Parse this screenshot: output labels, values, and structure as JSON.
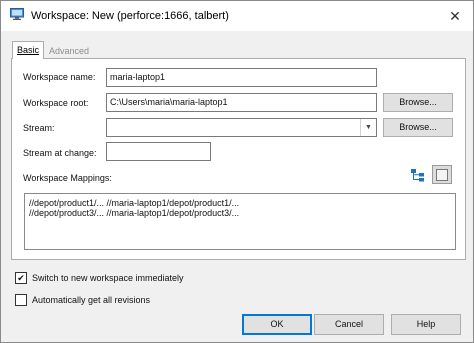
{
  "window": {
    "title": "Workspace: New (perforce:1666,  talbert)",
    "close_glyph": "✕"
  },
  "tabs": [
    {
      "label": "Basic"
    },
    {
      "label": "Advanced"
    }
  ],
  "form": {
    "workspace_name_label": "Workspace name:",
    "workspace_name_value": "maria-laptop1",
    "workspace_root_label": "Workspace root:",
    "workspace_root_value": "C:\\Users\\maria\\maria-laptop1",
    "stream_label": "Stream:",
    "stream_value": "",
    "stream_at_change_label": "Stream at change:",
    "stream_at_change_value": "",
    "browse_label": "Browse...",
    "mappings_label": "Workspace Mappings:"
  },
  "mappings": [
    "//depot/product1/...  //maria-laptop1/depot/product1/...",
    "//depot/product3/...  //maria-laptop1/depot/product3/..."
  ],
  "options": {
    "switch_label": "Switch to new workspace immediately",
    "switch_checked": "✔",
    "get_revisions_label": "Automatically get all revisions",
    "get_revisions_checked": ""
  },
  "buttons": {
    "ok": "OK",
    "cancel": "Cancel",
    "help": "Help"
  },
  "icons": {
    "window": "monitor-icon",
    "tree_view": "tree-view-icon",
    "text_view": "text-view-icon"
  },
  "colors": {
    "accent": "#0078d7",
    "tree_icon": "#1e73be"
  }
}
